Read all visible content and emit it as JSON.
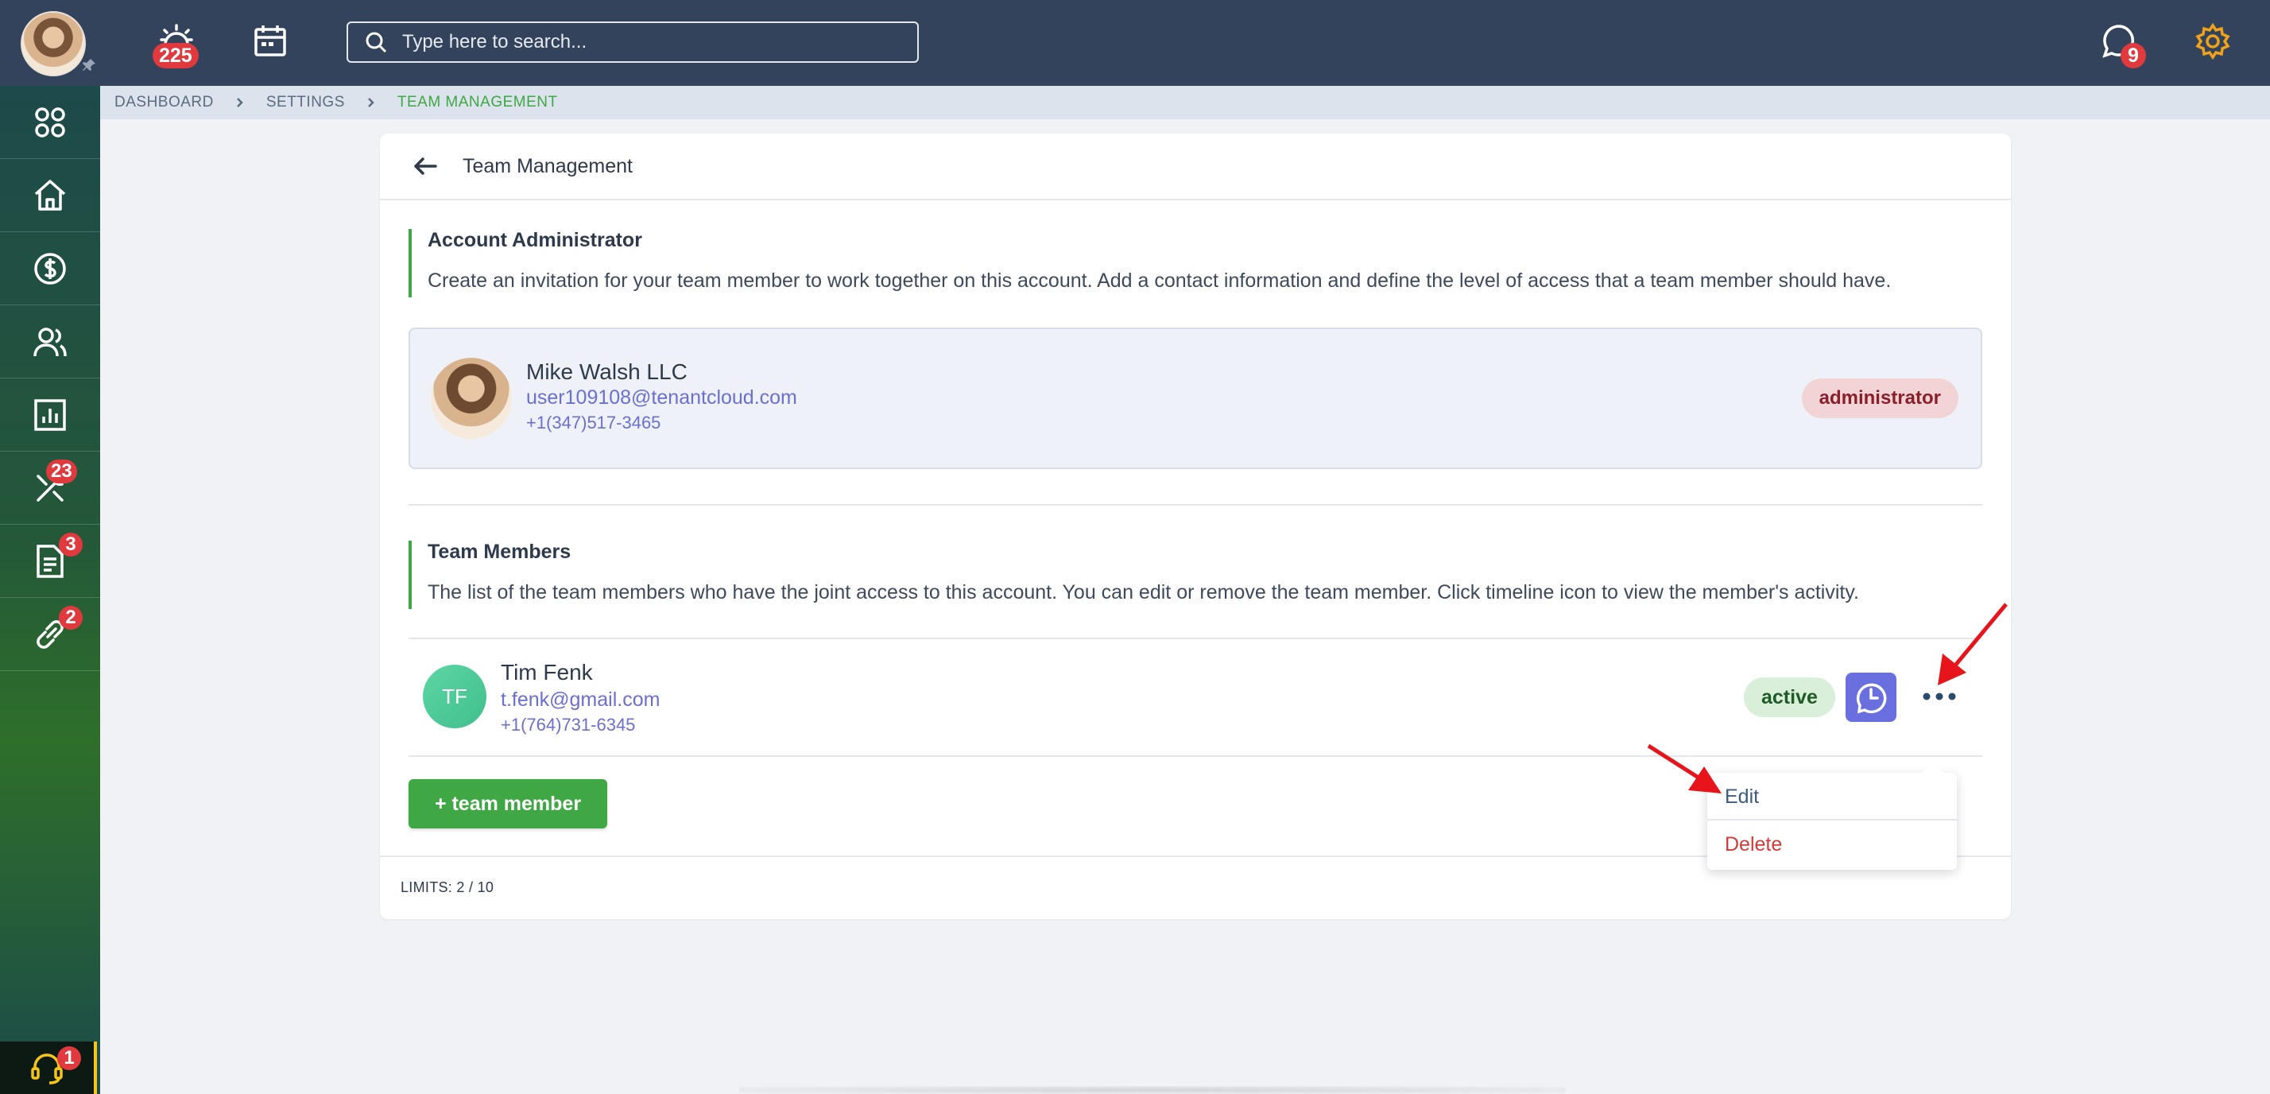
{
  "topbar": {
    "notifications_count": "225",
    "search_placeholder": "Type here to search...",
    "messages_count": "9"
  },
  "sidebar": {
    "items": [
      {
        "icon": "apps-icon",
        "badge": ""
      },
      {
        "icon": "home-icon",
        "badge": ""
      },
      {
        "icon": "dollar-icon",
        "badge": ""
      },
      {
        "icon": "users-icon",
        "badge": ""
      },
      {
        "icon": "reports-icon",
        "badge": ""
      },
      {
        "icon": "tools-icon",
        "badge": "23"
      },
      {
        "icon": "document-icon",
        "badge": "3"
      },
      {
        "icon": "link-icon",
        "badge": "2"
      }
    ],
    "support_badge": "1"
  },
  "breadcrumb": [
    "DASHBOARD",
    "SETTINGS",
    "TEAM MANAGEMENT"
  ],
  "card": {
    "title": "Team Management",
    "admin_section": {
      "title": "Account Administrator",
      "description": "Create an invitation for your team member to work together on this account. Add a contact information and define the level of access that a team member should have."
    },
    "admin": {
      "name": "Mike Walsh LLC",
      "email": "user109108@tenantcloud.com",
      "phone": "+1(347)517-3465",
      "role": "administrator"
    },
    "members_section": {
      "title": "Team Members",
      "description": "The list of the team members who have the joint access to this account. You can edit or remove the team member. Click timeline icon to view the member's activity."
    },
    "members": [
      {
        "initials": "TF",
        "name": "Tim Fenk",
        "email": "t.fenk@gmail.com",
        "phone": "+1(764)731-6345",
        "status": "active"
      }
    ],
    "add_button": "+ team member",
    "limits": "LIMITS: 2 / 10"
  },
  "dropdown": {
    "edit": "Edit",
    "delete": "Delete"
  },
  "colors": {
    "topbar": "#33435c",
    "accent_green": "#3fa744",
    "link_purple": "#6a6fd0",
    "badge_red": "#e0393e"
  }
}
